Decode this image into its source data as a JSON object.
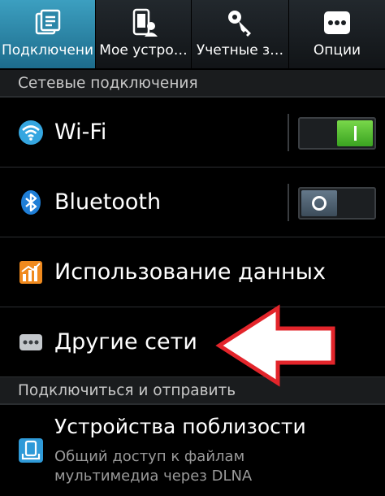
{
  "tabs": [
    {
      "label": "Подключени",
      "icon": "connections-icon",
      "active": true
    },
    {
      "label": "Мое устро…",
      "icon": "my-device-icon",
      "active": false
    },
    {
      "label": "Учетные з…",
      "icon": "accounts-key-icon",
      "active": false
    },
    {
      "label": "Опции",
      "icon": "options-dots-icon",
      "active": false
    }
  ],
  "sections": {
    "network": "Сетевые подключения",
    "connect_share": "Подключиться и отправить"
  },
  "rows": {
    "wifi": {
      "label": "Wi-Fi",
      "icon": "wifi-icon",
      "toggle": "on"
    },
    "bluetooth": {
      "label": "Bluetooth",
      "icon": "bluetooth-icon",
      "toggle": "off"
    },
    "data_usage": {
      "label": "Использование данных",
      "icon": "data-usage-icon"
    },
    "more_networks": {
      "label": "Другие сети",
      "icon": "more-dots-icon"
    }
  },
  "nearby": {
    "title": "Устройства поблизости",
    "subtitle_line1": "Общий доступ к файлам",
    "subtitle_line2": "мультимедиа через DLNA",
    "icon": "nearby-devices-icon"
  },
  "colors": {
    "active_tab": "#2b86a8",
    "toggle_on": "#5cc93a",
    "toggle_off": "#4d6275",
    "arrow": "#e3252b",
    "wifi": "#35a6e0",
    "bluetooth": "#1f7ed6",
    "data_usage": "#f08a1e"
  }
}
